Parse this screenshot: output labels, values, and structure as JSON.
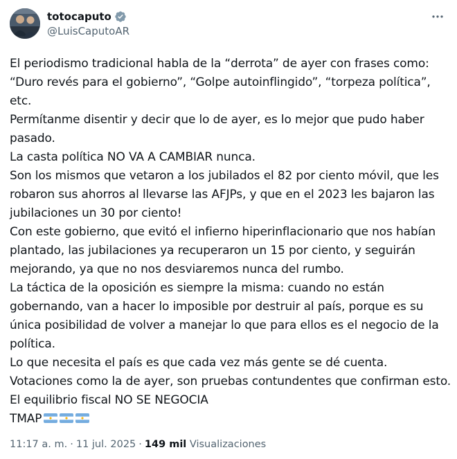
{
  "author": {
    "display_name": "totocaputo",
    "handle": "@LuisCaputoAR",
    "avatar": "avatar-photo",
    "verified_icon": "verified-badge-icon"
  },
  "more_icon": "more-options-icon",
  "tweet": {
    "lines": [
      "El periodismo tradicional habla de la “derrota” de ayer con frases como:",
      "“Duro revés para el gobierno”, “Golpe autoinflingido”, “torpeza política”,",
      "etc.",
      "Permítanme disentir y decir que lo de ayer, es lo mejor que pudo haber",
      "pasado.",
      "La casta política NO VA A CAMBIAR nunca.",
      "Son los mismos que vetaron a los jubilados el 82 por ciento móvil, que les",
      "robaron sus ahorros al llevarse las AFJPs, y que en el 2023 les bajaron las",
      "jubilaciones un 30 por ciento!",
      "Con este gobierno, que evitó el infierno hiperinflacionario que nos habían",
      "plantado, las jubilaciones ya recuperaron un 15 por ciento, y seguirán",
      "mejorando, ya que no nos desviaremos nunca del rumbo.",
      "La táctica de la oposición es siempre la misma: cuando no están",
      "gobernando, van a hacer lo imposible por destruir al país, porque es su",
      "única posibilidad de volver a manejar lo que para ellos es el negocio de la",
      "política.",
      "Lo que necesita el país es que cada vez más gente se dé cuenta.",
      "Votaciones como la de ayer, son pruebas contundentes que confirman esto.",
      "El equilibrio fiscal NO SE NEGOCIA",
      "TMAP"
    ],
    "flags": [
      "argentina-flag-icon",
      "argentina-flag-icon",
      "argentina-flag-icon"
    ]
  },
  "meta": {
    "time": "11:17 a. m.",
    "separator": "·",
    "date": "11 jul. 2025",
    "views_count": "149 mil",
    "views_label": "Visualizaciones"
  },
  "colors": {
    "text": "#0f1419",
    "secondary": "#536471",
    "verified": "#1d9bf0",
    "flag_blue": "#74acdf",
    "flag_sun": "#f6b40e"
  }
}
